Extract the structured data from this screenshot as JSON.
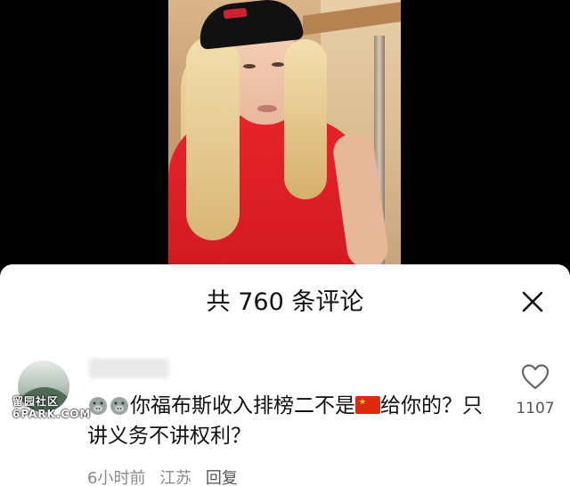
{
  "video": {},
  "comments_panel": {
    "title": "共 760 条评论",
    "close_icon": "close-icon"
  },
  "comment": {
    "text_part1": "你福布斯收入排榜二不是",
    "text_part2": "给你的？只讲义务不讲权利？",
    "emoji_icons": [
      "pig-face-emoji",
      "pig-face-emoji"
    ],
    "flag_icon": "china-flag-emoji",
    "time": "6小时前",
    "location": "江苏",
    "reply_label": "回复",
    "like_count": "1107",
    "like_icon": "heart-icon"
  },
  "watermark": {
    "line1": "留园社区",
    "line2": "6PARK.COM"
  },
  "colors": {
    "sheet_bg": "#ffffff",
    "meta_text": "#8a8a8a",
    "flag_red": "#de2910"
  }
}
